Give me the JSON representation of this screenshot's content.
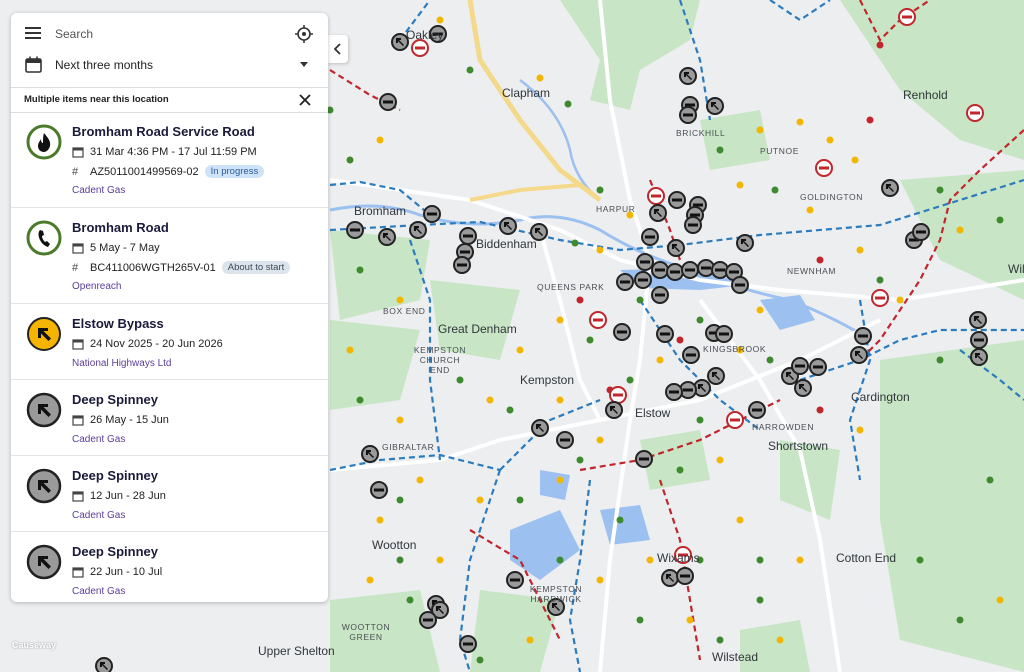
{
  "search": {
    "placeholder": "Search"
  },
  "date_filter": {
    "label": "Next three months"
  },
  "multi": {
    "header": "Multiple items near this location"
  },
  "items": [
    {
      "title": "Bromham Road Service Road",
      "icon": "flame-icon",
      "dates": "31 Mar 4:36 PM - 17 Jul 11:59 PM",
      "ref": "AZ5011001499569-02",
      "status": "In progress",
      "org": "Cadent Gas"
    },
    {
      "title": "Bromham Road",
      "icon": "phone-icon",
      "dates": "5 May - 7 May",
      "ref": "BC411006WGTH265V-01",
      "status": "About to start",
      "org": "Openreach"
    },
    {
      "title": "Elstow Bypass",
      "icon": "diversion-arrow-icon",
      "dates": "24 Nov 2025 - 20 Jun 2026",
      "org": "National Highways Ltd"
    },
    {
      "title": "Deep Spinney",
      "icon": "arrow-icon",
      "dates": "26 May - 15 Jun",
      "org": "Cadent Gas"
    },
    {
      "title": "Deep Spinney",
      "icon": "arrow-icon",
      "dates": "12 Jun - 28 Jun",
      "org": "Cadent Gas"
    },
    {
      "title": "Deep Spinney",
      "icon": "arrow-icon",
      "dates": "22 Jun - 10 Jul",
      "org": "Cadent Gas"
    }
  ],
  "map_labels": {
    "clapham": "Clapham",
    "renhold": "Renhold",
    "putnoe": "PUTNOE",
    "goldington": "GOLDINGTON",
    "harpur": "HARPUR",
    "biddenham": "Biddenham",
    "newnham": "NEWNHAM",
    "queens_park": "QUEENS PARK",
    "box_end": "BOX END",
    "great_denham": "Great Denham",
    "kingsbrook": "KINGSBROOK",
    "kempston_church_end": "KEMPSTON CHURCH END",
    "kempston": "Kempston",
    "elstow": "Elstow",
    "cardington": "Cardington",
    "harrowden": "HARROWDEN",
    "shortstown": "Shortstown",
    "gibraltar": "GIBRALTAR",
    "wootton": "Wootton",
    "wixams": "Wixams",
    "cotton_end": "Cotton End",
    "kempston_hardwick": "KEMPSTON HARDWICK",
    "wootton_green": "WOOTTON GREEN",
    "upper_shelton": "Upper Shelton",
    "wilstead": "Wilstead",
    "oakley": "Oakley",
    "bromham": "Bromham",
    "wil": "Wil",
    "brickhill": "BRICKHILL"
  },
  "branding": {
    "logo": "Causeway"
  },
  "colors": {
    "accent": "#1e6fb0",
    "road_work_blue": "#2b7bbf",
    "road_closure_red": "#c0262b",
    "minor_yellow": "#f2b600",
    "minor_green": "#3f8a2e"
  }
}
